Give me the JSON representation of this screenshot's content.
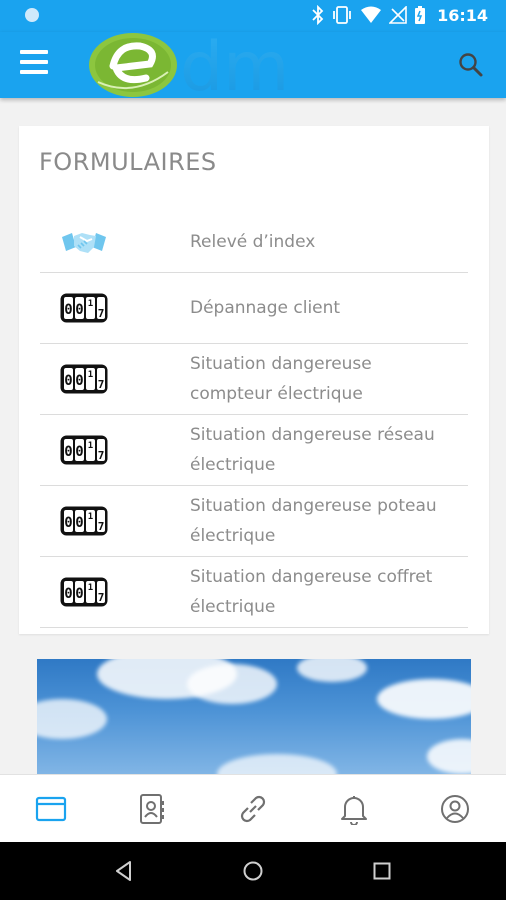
{
  "status_bar": {
    "time": "16:14"
  },
  "app_bar": {
    "logo_text": "dm",
    "logo_alt": "edm"
  },
  "card": {
    "title": "FORMULAIRES",
    "items": [
      {
        "label": "Relevé d’index",
        "icon": "handshake-icon"
      },
      {
        "label": "Dépannage client",
        "icon": "counter-icon"
      },
      {
        "label": "Situation dangereuse compteur électrique",
        "icon": "counter-icon"
      },
      {
        "label": "Situation dangereuse réseau électrique",
        "icon": "counter-icon"
      },
      {
        "label": "Situation dangereuse poteau électrique",
        "icon": "counter-icon"
      },
      {
        "label": "Situation dangereuse coffret électrique",
        "icon": "counter-icon"
      }
    ],
    "counter_digits": [
      "0",
      "0",
      "1",
      "7"
    ]
  },
  "bottom_nav": {
    "items": [
      "forms-icon",
      "contacts-icon",
      "link-icon",
      "bell-icon",
      "profile-icon"
    ],
    "active_color": "#1aa3ef",
    "inactive_color": "#707070"
  },
  "colors": {
    "accent": "#1aa3ef",
    "logo_green": "#8cc63f"
  }
}
